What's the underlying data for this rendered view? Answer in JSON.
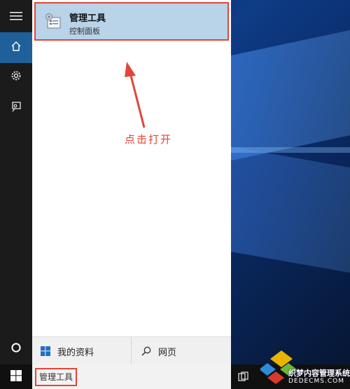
{
  "start_menu": {
    "rail": [
      {
        "icon": "hamburger-icon"
      },
      {
        "icon": "home-icon",
        "active": true
      },
      {
        "icon": "gear-icon"
      },
      {
        "icon": "feedback-icon"
      },
      {
        "icon": "cortana-circle-icon"
      }
    ],
    "best_match": {
      "icon": "administrative-tools-icon",
      "title": "管理工具",
      "subtitle": "控制面板"
    },
    "annotation": "点击打开",
    "filters": {
      "my_stuff": {
        "label": "我的资料",
        "icon": "windows-icon"
      },
      "web": {
        "label": "网页",
        "icon": "search-icon"
      }
    }
  },
  "taskbar": {
    "search_value": "管理工具",
    "start_icon": "windows-start-icon",
    "task_view_icon": "task-view-icon"
  },
  "watermark": {
    "text": "织梦内容管理系统",
    "url": "DEDECMS.COM"
  },
  "colors": {
    "accent": "#1f5f9a",
    "highlight_bg": "#b9d3e8",
    "annotation_red": "#e2453a",
    "rail_bg": "#1b1b1b"
  }
}
